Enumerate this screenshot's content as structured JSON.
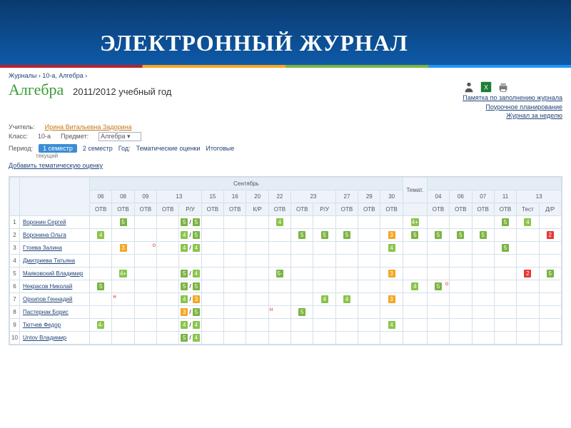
{
  "header": {
    "title": "ЭЛЕКТРОННЫЙ ЖУРНАЛ"
  },
  "breadcrumb": {
    "a": "Журналы",
    "b": "10-а, Алгебра"
  },
  "page": {
    "subject": "Алгебра",
    "year": "2011/2012 учебный год"
  },
  "links": {
    "l1": "Памятка по заполнению журнала",
    "l2": "Поурочное планирование",
    "l3": "Журнал за неделю"
  },
  "meta": {
    "teacher_label": "Учитель:",
    "teacher": "Ирина Витальевна Задорина",
    "class_label": "Класс:",
    "class": "10-а",
    "subject_label": "Предмет:",
    "subject_sel": "Алгебра",
    "period_label": "Период:",
    "p1": "1 семестр",
    "p2": "2 семестр",
    "py": "Год:",
    "pt": "Тематические оценки",
    "pi": "Итоговые",
    "current": "текущий",
    "add": "Добавить тематическую оценку"
  },
  "months": {
    "m1": "Сентябрь"
  },
  "days": [
    "06",
    "08",
    "09",
    "13",
    "15",
    "16",
    "20",
    "22",
    "23",
    "27",
    "29",
    "30"
  ],
  "extra_days": [
    "04",
    "06",
    "07",
    "11",
    "13"
  ],
  "types": [
    "ОТВ",
    "ОТВ",
    "ОТВ",
    "ОТВ",
    "Р/У",
    "ОТВ",
    "ОТВ",
    "К/Р",
    "ОТВ",
    "ОТВ",
    "Р/У",
    "ОТВ",
    "ОТВ",
    "ОТВ"
  ],
  "extra_types": [
    "ОТВ",
    "ОТВ",
    "ОТВ",
    "ОТВ",
    "Тест",
    "Д/Р"
  ],
  "themat": "Темат.",
  "students": [
    {
      "n": "1",
      "name": "Воронин Сергей"
    },
    {
      "n": "2",
      "name": "Воронина Ольга"
    },
    {
      "n": "3",
      "name": "Гтоева Залина"
    },
    {
      "n": "4",
      "name": "Дмитриева Татьяна"
    },
    {
      "n": "5",
      "name": "Маяковский Владимир"
    },
    {
      "n": "6",
      "name": "Некрасов Николай"
    },
    {
      "n": "7",
      "name": "Орхипов Геннадий"
    },
    {
      "n": "8",
      "name": "Пастернак Борис"
    },
    {
      "n": "9",
      "name": "Тютчев Федор"
    },
    {
      "n": "10",
      "name": "Untov Владимир"
    }
  ],
  "grades": {
    "r0": {
      "c1": "5",
      "c4": "5/5",
      "c8": "4",
      "c14": "4+",
      "c18": "5",
      "c19": "4"
    },
    "r1": {
      "c0": "4",
      "c4": "4/5",
      "c9": "5",
      "c10": "5",
      "c11": "5",
      "c13": "3",
      "c14": "5",
      "c15": "5",
      "c16": "5",
      "c17": "5",
      "c20": "2"
    },
    "r2": {
      "c1": "3",
      "c4": "4/4",
      "c13": "4",
      "c18": "5",
      "mark_c2": "о"
    },
    "r3": {},
    "r4": {
      "c1": "4+",
      "c4": "5/4",
      "c8": "5-",
      "c13": "3",
      "c19": "2",
      "c20": "5"
    },
    "r5": {
      "c0": "5",
      "c4": "5/5",
      "c14": "4",
      "c15": "5",
      "mark_c15": "о"
    },
    "r6": {
      "c4": "4/3",
      "c10": "4",
      "c11": "4",
      "c13": "3",
      "mark_c1": "н"
    },
    "r7": {
      "c4": "3/5",
      "c9": "5",
      "mark_c8": "н"
    },
    "r8": {
      "c0": "4-",
      "c4": "4/4",
      "c13": "4"
    },
    "r9": {
      "c4": "5/4"
    }
  }
}
